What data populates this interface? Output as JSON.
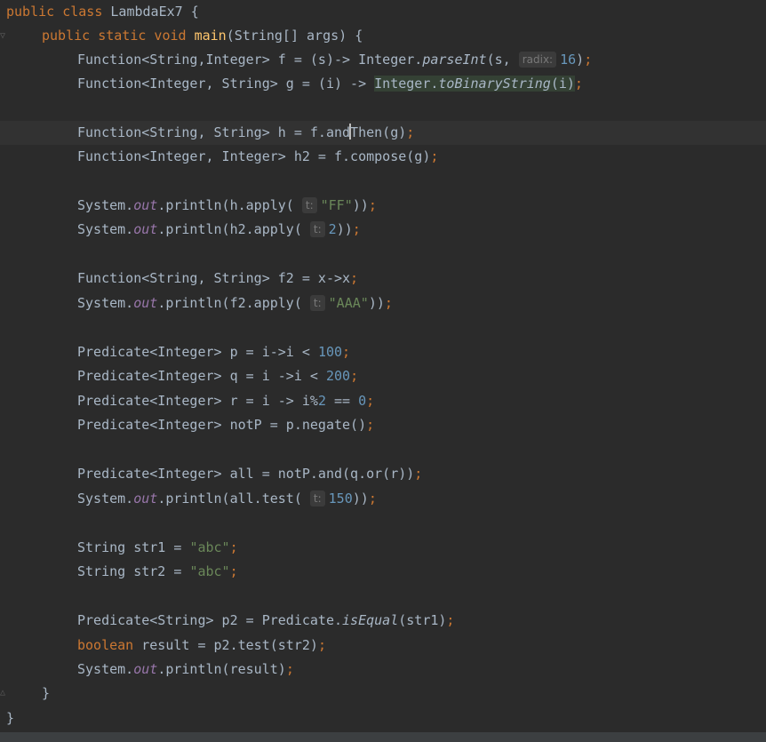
{
  "editor": {
    "class_keyword": "public class",
    "class_name": "LambdaEx7",
    "main_modifiers": "public static void",
    "main_name": "main",
    "main_params": "(String[] args) {",
    "hints": {
      "radix": "radix:",
      "t": "t:"
    },
    "lines": {
      "f_decl": "Function<String,Integer> f = (s)-> Integer.",
      "f_method": "parseInt",
      "f_args": "(s,",
      "f_num": "16",
      "g_decl": "Function<Integer, String> g = (i) -> ",
      "g_expr_a": "Integer.",
      "g_method": "toBinaryString",
      "g_expr_b": "(i)",
      "h_a": "Function<String, String> h = f.and",
      "h_b": "Then(g)",
      "h2": "Function<Integer, Integer> h2 = f.compose(g)",
      "sys": "System.",
      "out": "out",
      "println_h": ".println(h.apply(",
      "str_ff": "\"FF\"",
      "println_h2": ".println(h2.apply(",
      "num_2": "2",
      "f2_decl": "Function<String, String> f2 = x->x",
      "println_f2": ".println(f2.apply(",
      "str_aaa": "\"AAA\"",
      "p_decl": "Predicate<Integer> p = i->i < ",
      "num_100": "100",
      "q_decl": "Predicate<Integer> q = i ->i < ",
      "num_200": "200",
      "r_decl": "Predicate<Integer> r = i -> i%",
      "r_num2": "2",
      "r_eq": " == ",
      "r_num0": "0",
      "notp": "Predicate<Integer> notP = p.negate()",
      "all_decl": "Predicate<Integer> all = notP.and(q.or(r))",
      "println_all": ".println(all.test(",
      "num_150": "150",
      "str1_decl": "String str1 = ",
      "str_abc1": "\"abc\"",
      "str2_decl": "String str2 = ",
      "str_abc2": "\"abc\"",
      "p2_a": "Predicate<String> p2 = Predicate.",
      "p2_method": "isEqual",
      "p2_b": "(str1)",
      "bool_kw": "boolean",
      "result_decl": " result = p2.test(str2)",
      "println_result": ".println(result)",
      "close_close": "))",
      "close_paren": ")",
      "semi": ";",
      "comma": ",",
      "brace_close": "}"
    }
  }
}
